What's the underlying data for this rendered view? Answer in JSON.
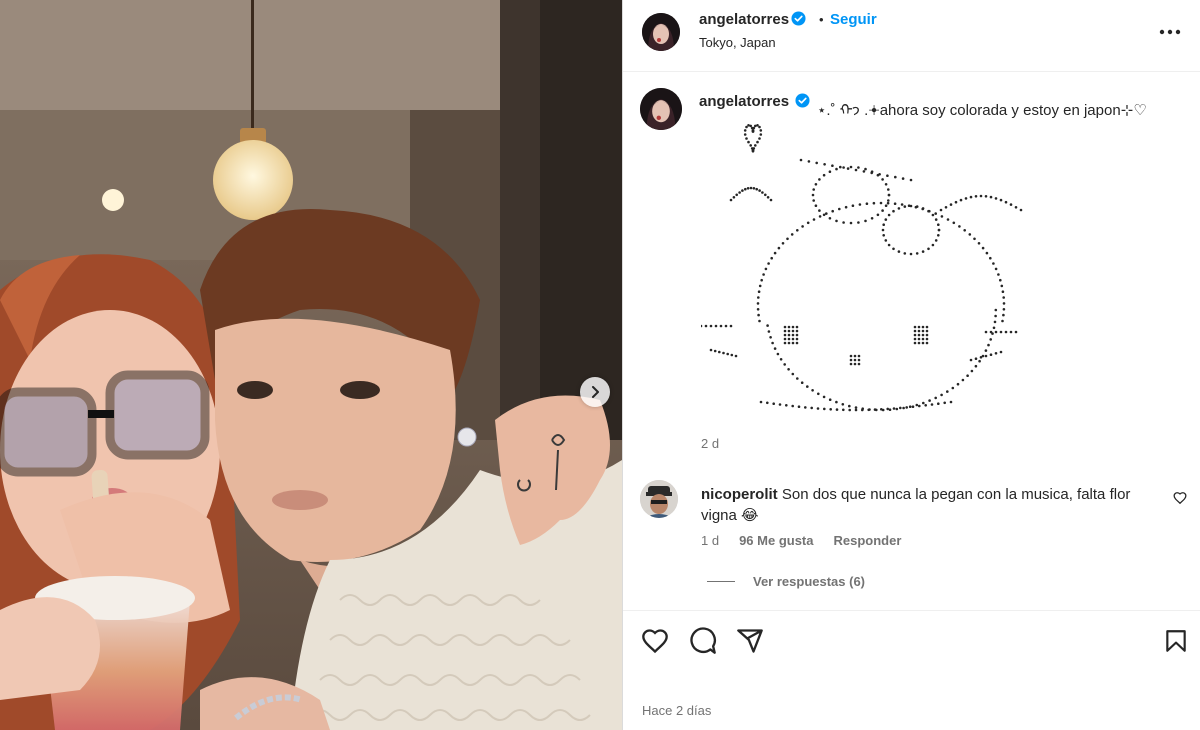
{
  "post": {
    "username": "angelatorres",
    "follow_label": "Seguir",
    "dot": "•",
    "location": "Tokyo, Japan",
    "caption": "⋆.˚ ᡣ𐭩 .𖥔ahora soy colorada y estoy en japon⊹♡",
    "age": "2 d",
    "time_ago": "Hace 2 días"
  },
  "comment": {
    "username": "nicoperolit",
    "text": "Son dos que nunca la pegan con la musica, falta flor vigna 😂",
    "age": "1 d",
    "likes": "96 Me gusta",
    "reply_label": "Responder",
    "view_replies": "Ver respuestas (6)"
  },
  "colors": {
    "accent": "#0095f6",
    "text": "#262626",
    "secondary": "#737373",
    "verified": "#0095f6"
  },
  "icons": {
    "more": "more-horizontal-icon",
    "like": "heart-icon",
    "comment": "comment-icon",
    "share": "send-icon",
    "save": "bookmark-icon",
    "next": "chevron-right-icon",
    "verified": "verified-badge-icon"
  }
}
